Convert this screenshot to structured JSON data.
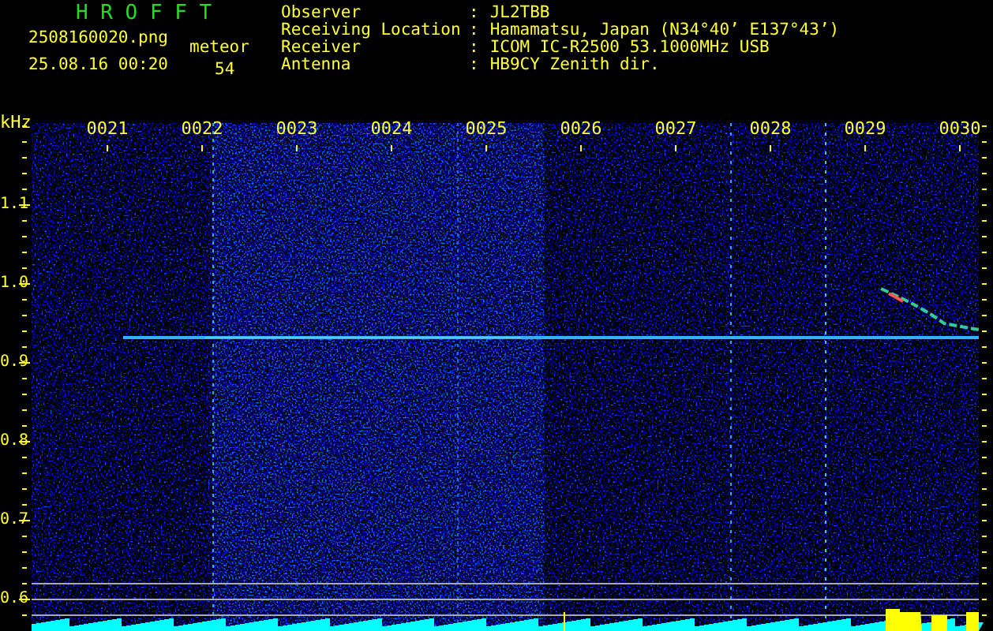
{
  "app_title": "H R O F F T",
  "file_name": "2508160020.png",
  "timestamp": "25.08.16 00:20",
  "meteor": {
    "label": "meteor",
    "count": "54"
  },
  "station_info": [
    {
      "label": "Observer",
      "value": "JL2TBB"
    },
    {
      "label": "Receiving Location",
      "value": "Hamamatsu, Japan (N34°40’ E137°43’)"
    },
    {
      "label": "Receiver",
      "value": "ICOM IC-R2500 53.1000MHz USB"
    },
    {
      "label": "Antenna",
      "value": "HB9CY Zenith dir."
    }
  ],
  "separator": ":",
  "spectrogram": {
    "unit": "kHz",
    "freq_labels": [
      "1.1",
      "1.0",
      "0.9",
      "0.8",
      "0.7",
      "0.6"
    ],
    "time_labels": [
      "0021",
      "0022",
      "0023",
      "0024",
      "0025",
      "0026",
      "0027",
      "0028",
      "0029",
      "0030"
    ]
  }
}
